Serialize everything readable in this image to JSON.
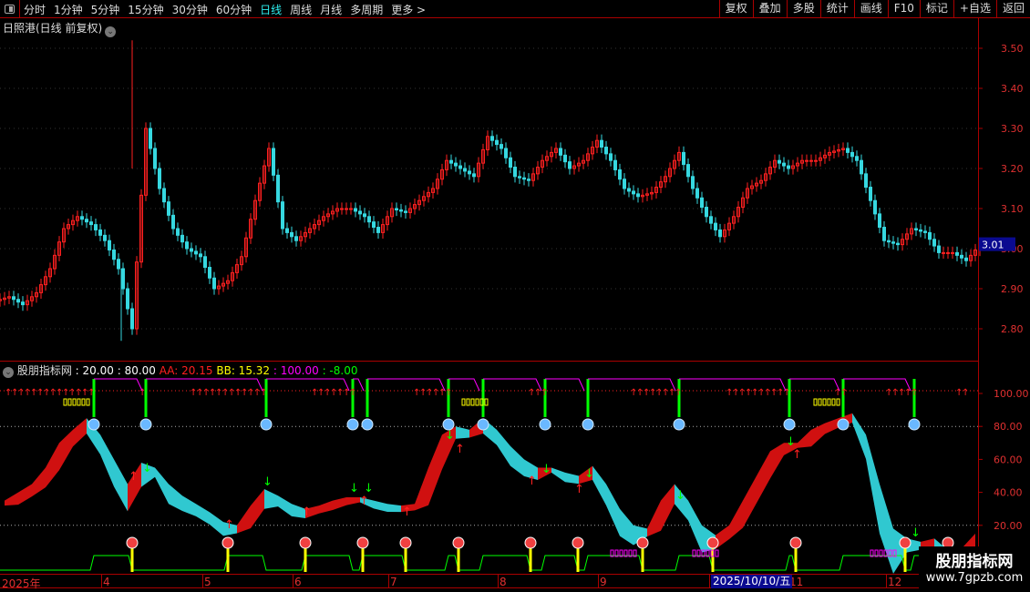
{
  "toolbar": {
    "periods": [
      "分时",
      "1分钟",
      "5分钟",
      "15分钟",
      "30分钟",
      "60分钟",
      "日线",
      "周线",
      "月线",
      "多周期",
      "更多 >"
    ],
    "active": "日线",
    "tools": [
      "复权",
      "叠加",
      "多股",
      "统计",
      "画线",
      "F10",
      "标记",
      "+自选",
      "返回"
    ]
  },
  "main_title": "日照港(日线 前复权)",
  "indicator": {
    "name": "股朋指标网",
    "p1": ": 20.00",
    "p2": ": 80.00",
    "aa": "AA: 20.15",
    "bb": "BB: 15.32",
    "p3": ": 100.00",
    "p4": ": -8.00"
  },
  "colors": {
    "up": "#ff2020",
    "down": "#36d8e0",
    "axis": "#aa0000",
    "ma_line": "#ff00ff",
    "green": "#00ff00",
    "yellow": "#ffff00"
  },
  "watermark": {
    "name": "股朋指标网",
    "url": "www.7gpzb.com"
  },
  "chart_data": [
    {
      "type": "candlestick",
      "title": "日照港(日线 前复权)",
      "ylim": [
        2.72,
        3.58
      ],
      "yticks": [
        "3.50",
        "3.40",
        "3.30",
        "3.20",
        "3.10",
        "3.00",
        "2.90",
        "2.80"
      ],
      "last_price_label": "3.01",
      "close": [
        2.88,
        2.86,
        2.89,
        2.95,
        3.05,
        3.08,
        3.06,
        3.02,
        2.95,
        2.8,
        3.3,
        3.15,
        3.05,
        3.0,
        2.98,
        2.9,
        2.92,
        2.98,
        3.12,
        3.25,
        3.05,
        3.02,
        3.05,
        3.08,
        3.1,
        3.1,
        3.08,
        3.04,
        3.1,
        3.09,
        3.12,
        3.15,
        3.22,
        3.2,
        3.18,
        3.28,
        3.25,
        3.18,
        3.17,
        3.22,
        3.25,
        3.2,
        3.22,
        3.27,
        3.22,
        3.15,
        3.13,
        3.14,
        3.18,
        3.24,
        3.15,
        3.08,
        3.03,
        3.08,
        3.15,
        3.17,
        3.22,
        3.2,
        3.22,
        3.22,
        3.24,
        3.25,
        3.22,
        3.12,
        3.02,
        3.01,
        3.05,
        3.04,
        2.99,
        2.99,
        2.97,
        3.01
      ]
    },
    {
      "type": "area",
      "title": "股朋指标网",
      "ylim": [
        -8,
        112
      ],
      "yticks": [
        "100.00",
        "80.00",
        "60.00",
        "40.00",
        "20.00"
      ],
      "AA": [
        35,
        40,
        45,
        55,
        70,
        78,
        85,
        75,
        60,
        45,
        58,
        55,
        45,
        38,
        33,
        28,
        22,
        20,
        32,
        42,
        38,
        33,
        30,
        32,
        35,
        37,
        37,
        35,
        33,
        32,
        33,
        55,
        75,
        80,
        78,
        85,
        78,
        68,
        60,
        55,
        55,
        52,
        50,
        56,
        45,
        30,
        20,
        18,
        35,
        45,
        35,
        20,
        14,
        20,
        35,
        50,
        65,
        70,
        70,
        78,
        82,
        85,
        88,
        75,
        45,
        18,
        12,
        10,
        12,
        5,
        6,
        15
      ]
    },
    {
      "type": "axis",
      "x_ticks": [
        "2025年",
        "4",
        "5",
        "6",
        "7",
        "8",
        "9",
        "10",
        "11",
        "12"
      ],
      "cursor_date": "2025/10/10/五"
    }
  ]
}
